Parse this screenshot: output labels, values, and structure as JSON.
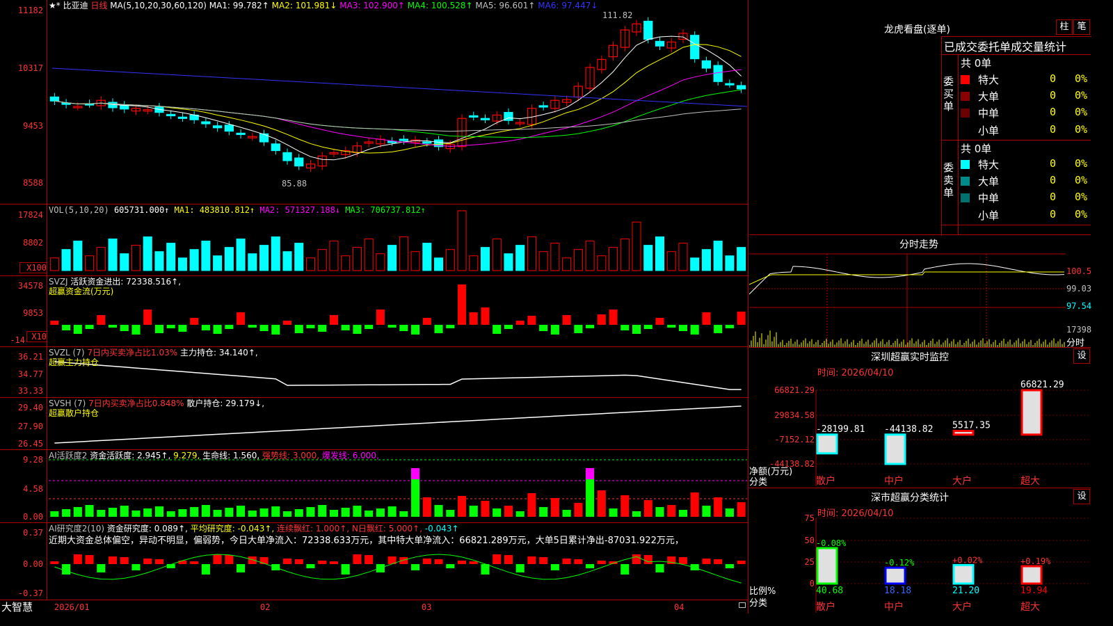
{
  "app": {
    "brand": "大智慧",
    "stock": "比亚迪",
    "period": "日线",
    "stars": "★*"
  },
  "kline": {
    "ma_label": "MA(5,10,20,30,60,120)",
    "ma": [
      {
        "label": "MA1: 99.782↑",
        "color": "#ffffff"
      },
      {
        "label": "MA2: 101.981↓",
        "color": "#ffff00"
      },
      {
        "label": "MA3: 102.900↑",
        "color": "#ff00ff"
      },
      {
        "label": "MA4: 100.528↑",
        "color": "#00ff00"
      },
      {
        "label": "MA5: 96.601↑",
        "color": "#c0c0c0"
      },
      {
        "label": "MA6: 97.447↓",
        "color": "#3333ff"
      }
    ],
    "y_ticks": [
      "11182",
      "10317",
      "9453",
      "8588"
    ],
    "high_note": "111.82",
    "low_note": "85.88"
  },
  "vol": {
    "title": "VOL(5,10,20)",
    "value": "605731.000↑",
    "ma1": "MA1: 483810.812↑",
    "ma2": "MA2: 571327.188↓",
    "ma3": "MA3: 706737.812↑",
    "y_ticks": [
      "17824",
      "8802"
    ],
    "unit": "X100"
  },
  "svzj": {
    "title": "SVZJ",
    "label": "活跃资金进出: 72338.516↑,",
    "sub": "超赢资金流(万元)",
    "y_ticks": [
      "34578",
      "9853",
      "-14"
    ],
    "unit": "X10"
  },
  "svzl": {
    "title": "SVZL (7)",
    "label1": "7日内买卖净占比1.03%",
    "label2": "主力持仓: 34.140↑,",
    "sub": "超赢主力持仓",
    "y_ticks": [
      "36.21",
      "34.77",
      "33.33"
    ]
  },
  "svsh": {
    "title": "SVSH (7)",
    "label1": "7日内买卖净占比0.848%",
    "label2": "散户持仓: 29.179↓,",
    "sub": "超赢散户持仓",
    "y_ticks": [
      "29.40",
      "27.90",
      "26.45"
    ]
  },
  "ai2": {
    "title": "AI活跃度2",
    "l1": "资金活跃度: 2.945↑,",
    "l2": "9.279,",
    "l3": "生命线: 1.560,",
    "l4": "强势线: 3.000,",
    "l5": "爆发线: 6.000,",
    "y_ticks": [
      "9.28",
      "4.58",
      "0.00"
    ]
  },
  "ai_res": {
    "title": "AI研究度2(10)",
    "l1": "资金研究度: 0.089↑,",
    "l2": "平均研究度: -0.043↑,",
    "l3": "连续飘红: 1.000↑,",
    "l4": "N日飘红: 5.000↑,",
    "l5": "-0.043↑",
    "summary": "近期大资金总体偏空，异动不明显，偏弱势，今日大单净流入：72338.633万元，其中特大单净流入：66821.289万元，大单5日累计净出-87031.922万元，",
    "y_ticks": [
      "0.37",
      "0.00",
      "-0.37"
    ]
  },
  "x_axis": [
    "2026/01",
    "02",
    "03",
    "04"
  ],
  "dragon": {
    "title": "龙虎看盘(逐单)",
    "btn1": "柱",
    "btn2": "笔",
    "subtitle": "已成交委托单成交量统计",
    "buy": {
      "side": "委买单",
      "total": "共 0单",
      "rows": [
        {
          "label": "特大",
          "value": "0",
          "pct": "0%",
          "color": "#ff0000"
        },
        {
          "label": "大单",
          "value": "0",
          "pct": "0%",
          "color": "#8b0000"
        },
        {
          "label": "中单",
          "value": "0",
          "pct": "0%",
          "color": "#6b0000"
        },
        {
          "label": "小单",
          "value": "0",
          "pct": "0%",
          "color": "#000000"
        }
      ]
    },
    "sell": {
      "side": "委卖单",
      "total": "共 0单",
      "rows": [
        {
          "label": "特大",
          "value": "0",
          "pct": "0%",
          "color": "#00ffff"
        },
        {
          "label": "大单",
          "value": "0",
          "pct": "0%",
          "color": "#008b8b"
        },
        {
          "label": "中单",
          "value": "0",
          "pct": "0%",
          "color": "#007070"
        },
        {
          "label": "小单",
          "value": "0",
          "pct": "0%",
          "color": "#000000"
        }
      ]
    }
  },
  "intraday": {
    "title": "分时走势",
    "y_ticks": [
      "100.5",
      "99.03",
      "97.54"
    ],
    "vol_tick": "17398",
    "unit": "分时"
  },
  "monitor": {
    "title": "深圳超赢实时监控",
    "btn": "设",
    "time": "时间: 2026/04/10",
    "y_ticks": [
      "66821.29",
      "29834.58",
      "-7152.12",
      "-44138.82"
    ],
    "ylabel": "净额(万元)",
    "xlabel": "分类"
  },
  "classify": {
    "title": "深市超赢分类统计",
    "btn": "设",
    "time": "时间: 2026/04/10",
    "y_ticks": [
      "75",
      "50",
      "25",
      "0"
    ],
    "ylabel": "比例%",
    "xlabel": "分类"
  },
  "colors": {
    "up": "#ff0000",
    "down": "#00ffff",
    "grid": "#b00000"
  },
  "chart_data": [
    {
      "type": "bar",
      "title": "深圳超赢实时监控",
      "categories": [
        "散户",
        "中户",
        "大户",
        "超大"
      ],
      "values": [
        -28199.81,
        -44138.82,
        5517.35,
        66821.29
      ],
      "ylabel": "净额(万元)",
      "xlabel": "分类",
      "ylim": [
        -44138.82,
        66821.29
      ]
    },
    {
      "type": "bar",
      "title": "深市超赢分类统计",
      "categories": [
        "散户",
        "中户",
        "大户",
        "超大"
      ],
      "values": [
        40.68,
        18.18,
        21.2,
        19.94
      ],
      "changes": [
        "-0.08%",
        "-0.12%",
        "+0.02%",
        "+0.19%"
      ],
      "ylabel": "比例%",
      "xlabel": "分类",
      "ylim": [
        0,
        75
      ]
    }
  ]
}
